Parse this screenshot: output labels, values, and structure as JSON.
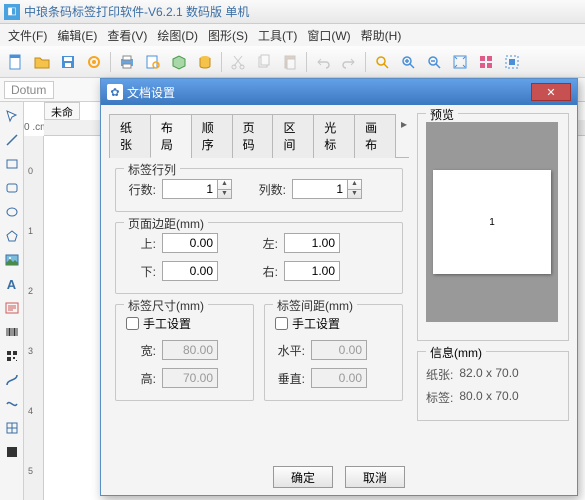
{
  "app": {
    "title": "中琅条码标签打印软件-V6.2.1 数码版 单机"
  },
  "menu": {
    "file": "文件(F)",
    "edit": "编辑(E)",
    "view": "查看(V)",
    "draw": "绘图(D)",
    "shape": "图形(S)",
    "tool": "工具(T)",
    "window": "窗口(W)",
    "help": "帮助(H)"
  },
  "fontbar": {
    "font": "Dotum",
    "doctab": "未命",
    "cm": "0 .cm"
  },
  "dialog": {
    "title": "文档设置",
    "tabs": {
      "paper": "纸张",
      "layout": "布局",
      "order": "顺序",
      "pagecode": "页码",
      "range": "区间",
      "cursor": "光标",
      "canvas": "画布"
    },
    "groups": {
      "rowscols": {
        "title": "标签行列",
        "rows_lbl": "行数:",
        "rows_val": "1",
        "cols_lbl": "列数:",
        "cols_val": "1"
      },
      "margin": {
        "title": "页面边距(mm)",
        "top_lbl": "上:",
        "top_val": "0.00",
        "left_lbl": "左:",
        "left_val": "1.00",
        "bottom_lbl": "下:",
        "bottom_val": "0.00",
        "right_lbl": "右:",
        "right_val": "1.00"
      },
      "size": {
        "title": "标签尺寸(mm)",
        "manual": "手工设置",
        "w_lbl": "宽:",
        "w_val": "80.00",
        "h_lbl": "高:",
        "h_val": "70.00"
      },
      "gap": {
        "title": "标签间距(mm)",
        "manual": "手工设置",
        "h_lbl": "水平:",
        "h_val": "0.00",
        "v_lbl": "垂直:",
        "v_val": "0.00"
      }
    },
    "preview": {
      "title": "预览",
      "page_num": "1"
    },
    "info": {
      "title": "信息(mm)",
      "paper_lbl": "纸张:",
      "paper_val": "82.0 x 70.0",
      "label_lbl": "标签:",
      "label_val": "80.0 x 70.0"
    },
    "buttons": {
      "ok": "确定",
      "cancel": "取消"
    }
  }
}
